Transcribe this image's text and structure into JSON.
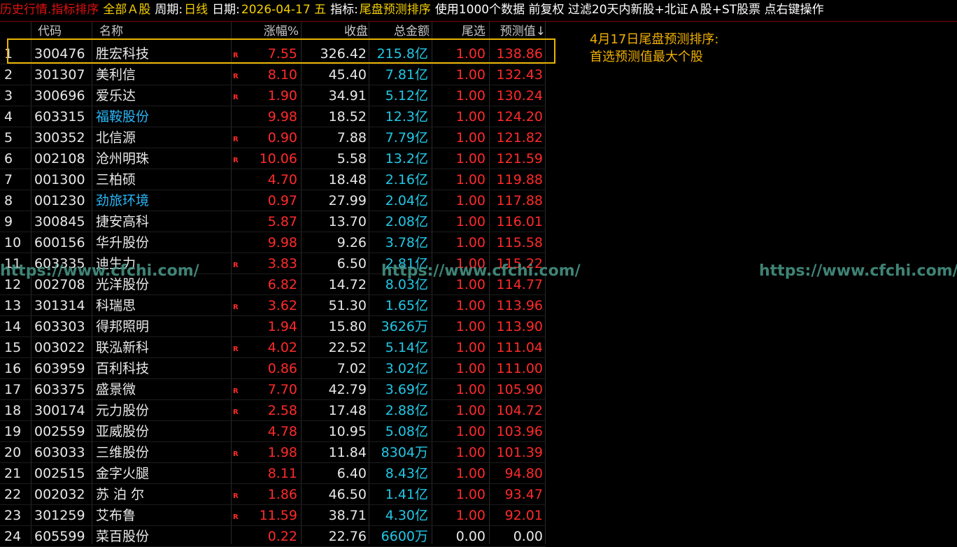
{
  "topbar": {
    "title": "历史行情.指标排序",
    "market": "全部Ａ股",
    "period_label": "周期:",
    "period": "日线",
    "date_label": "日期:",
    "date": "2026-04-17 五",
    "indicator_label": "指标:",
    "indicator": "尾盘预测排序",
    "info": "使用1000个数据 前复权 过滤20天内新股+北证Ａ股+ST股票 点右键操作"
  },
  "headers": {
    "code": "代码",
    "name": "名称",
    "pct": "涨幅%",
    "close": "收盘",
    "amount": "总金额",
    "tail": "尾选",
    "pred": "预测值↓"
  },
  "note": {
    "line1": "4月17日尾盘预测排序:",
    "line2": "首选预测值最大个股"
  },
  "watermark": "https://www.cfchi.com/",
  "colors": {
    "up": "#ff2a2a",
    "amount": "#22c8e6",
    "highlight_name": "#29b6f6",
    "selection": "#e8b400"
  },
  "rows": [
    {
      "idx": "1",
      "code": "300476",
      "name": "胜宏科技",
      "name_blue": false,
      "r": "R",
      "pct": "7.55",
      "close": "326.42",
      "amount": "215.8亿",
      "tail": "1.00",
      "pred": "138.86"
    },
    {
      "idx": "2",
      "code": "301307",
      "name": "美利信",
      "name_blue": false,
      "r": "R",
      "pct": "8.10",
      "close": "45.40",
      "amount": "7.81亿",
      "tail": "1.00",
      "pred": "132.43"
    },
    {
      "idx": "3",
      "code": "300696",
      "name": "爱乐达",
      "name_blue": false,
      "r": "R",
      "pct": "1.90",
      "close": "34.91",
      "amount": "5.12亿",
      "tail": "1.00",
      "pred": "130.24"
    },
    {
      "idx": "4",
      "code": "603315",
      "name": "福鞍股份",
      "name_blue": true,
      "r": "",
      "pct": "9.98",
      "close": "18.52",
      "amount": "12.3亿",
      "tail": "1.00",
      "pred": "124.20"
    },
    {
      "idx": "5",
      "code": "300352",
      "name": "北信源",
      "name_blue": false,
      "r": "R",
      "pct": "0.90",
      "close": "7.88",
      "amount": "7.79亿",
      "tail": "1.00",
      "pred": "121.82"
    },
    {
      "idx": "6",
      "code": "002108",
      "name": "沧州明珠",
      "name_blue": false,
      "r": "R",
      "pct": "10.06",
      "close": "5.58",
      "amount": "13.2亿",
      "tail": "1.00",
      "pred": "121.59"
    },
    {
      "idx": "7",
      "code": "001300",
      "name": "三柏硕",
      "name_blue": false,
      "r": "",
      "pct": "4.70",
      "close": "18.48",
      "amount": "2.16亿",
      "tail": "1.00",
      "pred": "119.88"
    },
    {
      "idx": "8",
      "code": "001230",
      "name": "劲旅环境",
      "name_blue": true,
      "r": "",
      "pct": "0.97",
      "close": "27.99",
      "amount": "2.04亿",
      "tail": "1.00",
      "pred": "117.88"
    },
    {
      "idx": "9",
      "code": "300845",
      "name": "捷安高科",
      "name_blue": false,
      "r": "",
      "pct": "5.87",
      "close": "13.70",
      "amount": "2.08亿",
      "tail": "1.00",
      "pred": "116.01"
    },
    {
      "idx": "10",
      "code": "600156",
      "name": "华升股份",
      "name_blue": false,
      "r": "",
      "pct": "9.98",
      "close": "9.26",
      "amount": "3.78亿",
      "tail": "1.00",
      "pred": "115.58"
    },
    {
      "idx": "11",
      "code": "603335",
      "name": "迪生力",
      "name_blue": false,
      "r": "R",
      "pct": "3.83",
      "close": "6.50",
      "amount": "2.81亿",
      "tail": "1.00",
      "pred": "115.22"
    },
    {
      "idx": "12",
      "code": "002708",
      "name": "光洋股份",
      "name_blue": false,
      "r": "",
      "pct": "6.82",
      "close": "14.72",
      "amount": "8.03亿",
      "tail": "1.00",
      "pred": "114.77"
    },
    {
      "idx": "13",
      "code": "301314",
      "name": "科瑞思",
      "name_blue": false,
      "r": "R",
      "pct": "3.62",
      "close": "51.30",
      "amount": "1.65亿",
      "tail": "1.00",
      "pred": "113.96"
    },
    {
      "idx": "14",
      "code": "603303",
      "name": "得邦照明",
      "name_blue": false,
      "r": "",
      "pct": "1.94",
      "close": "15.80",
      "amount": "3626万",
      "tail": "1.00",
      "pred": "113.90"
    },
    {
      "idx": "15",
      "code": "003022",
      "name": "联泓新科",
      "name_blue": false,
      "r": "R",
      "pct": "4.02",
      "close": "22.52",
      "amount": "5.14亿",
      "tail": "1.00",
      "pred": "111.04"
    },
    {
      "idx": "16",
      "code": "603959",
      "name": "百利科技",
      "name_blue": false,
      "r": "",
      "pct": "0.86",
      "close": "7.02",
      "amount": "3.02亿",
      "tail": "1.00",
      "pred": "111.00"
    },
    {
      "idx": "17",
      "code": "603375",
      "name": "盛景微",
      "name_blue": false,
      "r": "R",
      "pct": "7.70",
      "close": "42.79",
      "amount": "3.69亿",
      "tail": "1.00",
      "pred": "105.90"
    },
    {
      "idx": "18",
      "code": "300174",
      "name": "元力股份",
      "name_blue": false,
      "r": "R",
      "pct": "2.58",
      "close": "17.48",
      "amount": "2.88亿",
      "tail": "1.00",
      "pred": "104.72"
    },
    {
      "idx": "19",
      "code": "002559",
      "name": "亚威股份",
      "name_blue": false,
      "r": "",
      "pct": "4.78",
      "close": "10.95",
      "amount": "5.08亿",
      "tail": "1.00",
      "pred": "103.96"
    },
    {
      "idx": "20",
      "code": "603033",
      "name": "三维股份",
      "name_blue": false,
      "r": "R",
      "pct": "1.98",
      "close": "11.84",
      "amount": "8304万",
      "tail": "1.00",
      "pred": "101.39"
    },
    {
      "idx": "21",
      "code": "002515",
      "name": "金字火腿",
      "name_blue": false,
      "r": "",
      "pct": "8.11",
      "close": "6.40",
      "amount": "8.43亿",
      "tail": "1.00",
      "pred": "94.80"
    },
    {
      "idx": "22",
      "code": "002032",
      "name": "苏 泊 尔",
      "name_blue": false,
      "r": "R",
      "pct": "1.86",
      "close": "46.50",
      "amount": "1.41亿",
      "tail": "1.00",
      "pred": "93.47"
    },
    {
      "idx": "23",
      "code": "301259",
      "name": "艾布鲁",
      "name_blue": false,
      "r": "R",
      "pct": "11.59",
      "close": "38.71",
      "amount": "4.30亿",
      "tail": "1.00",
      "pred": "92.01"
    },
    {
      "idx": "24",
      "code": "605599",
      "name": "菜百股份",
      "name_blue": false,
      "r": "",
      "pct": "0.22",
      "close": "22.76",
      "amount": "6600万",
      "tail": "0.00",
      "pred": "0.00"
    }
  ]
}
